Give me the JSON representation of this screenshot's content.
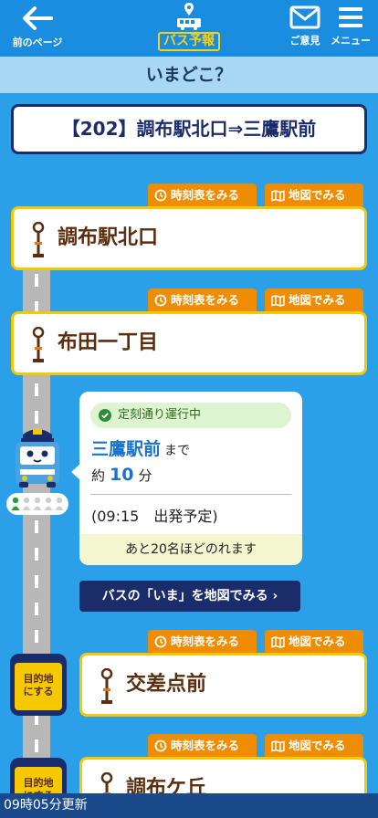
{
  "header": {
    "back_label": "前のページ",
    "logo_text": "バス予報",
    "opinion_label": "ご意見",
    "menu_label": "メニュー"
  },
  "page_title": "いまどこ？",
  "route_title": "【202】調布駅北口⇒三鷹駅前",
  "links": {
    "timetable": "時刻表をみる",
    "map": "地図でみる"
  },
  "stops": [
    {
      "name": "調布駅北口"
    },
    {
      "name": "布田一丁目"
    },
    {
      "name": "交差点前"
    },
    {
      "name": "調布ケ丘"
    }
  ],
  "status": {
    "ontime_label": "定刻通り運行中",
    "destination": "三鷹駅前",
    "made": "まで",
    "approx": "約",
    "minutes": "10",
    "minutes_unit": "分",
    "departure": "(09:15　出発予定)",
    "remaining": "あと20名ほどのれます",
    "occupancy": 0.2
  },
  "map_button_label": "バスの「いま」を地図でみる ›",
  "set_destination_label_line1": "目的地",
  "set_destination_label_line2": "にする",
  "updated_text": "09時05分更新",
  "colors": {
    "background": "#2ba0e8",
    "header": "#1a8de0",
    "accent_orange": "#f08c00",
    "card_border": "#f5c800",
    "navy": "#1b2c6b"
  }
}
